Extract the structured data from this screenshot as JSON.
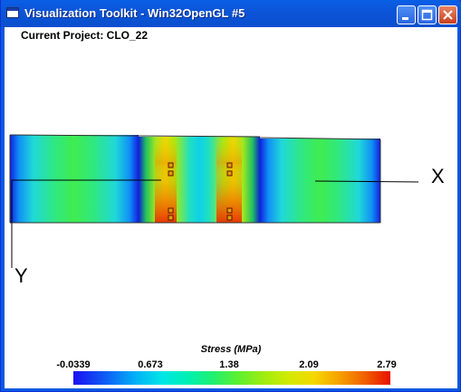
{
  "window": {
    "title": "Visualization Toolkit - Win32OpenGL #5",
    "icon": "vtk-window-icon",
    "buttons": [
      "minimize",
      "maximize",
      "close"
    ]
  },
  "viewport": {
    "project_label": "Current Project: CLO_22",
    "axis_x_label": "X",
    "axis_y_label": "Y"
  },
  "scalar_bar": {
    "title": "Stress (MPa)",
    "ticks": [
      "-0.0339",
      "0.673",
      "1.38",
      "2.09",
      "2.79"
    ],
    "colors": {
      "low": "#1b10f0",
      "mid": "#20f070",
      "high": "#e81000"
    }
  }
}
